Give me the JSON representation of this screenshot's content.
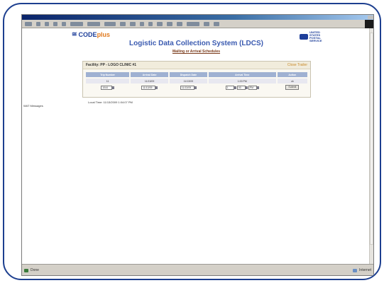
{
  "brand": {
    "logo_text": "CODE",
    "logo_plus": "plus",
    "usps_text": "UNITED STATES POSTAL SERVICE"
  },
  "page": {
    "title": "Logistic Data Collection System (LDCS)",
    "subtitle": "Mailing or Arrival Schedules"
  },
  "panel": {
    "title": "Facility: PP - LOGO CLINIC #1",
    "link": "Close Trailer",
    "headers": [
      "Trip Number",
      "Arrival Date",
      "Dispatch Date",
      "Arrival Time",
      "Action"
    ],
    "row": [
      "11",
      "11/13/09",
      "11/13/09",
      "1:00 PM",
      "ok"
    ],
    "inputs": [
      "1044",
      "11/13/09",
      "11/13/09",
      "1",
      "00",
      "PM"
    ],
    "button": "Submit"
  },
  "footer": {
    "local_time": "Local Time: 11/13/2009 1:04:07 PM",
    "left_label": "WAT Messages"
  },
  "status": {
    "left": "Done",
    "right": "Internet"
  }
}
